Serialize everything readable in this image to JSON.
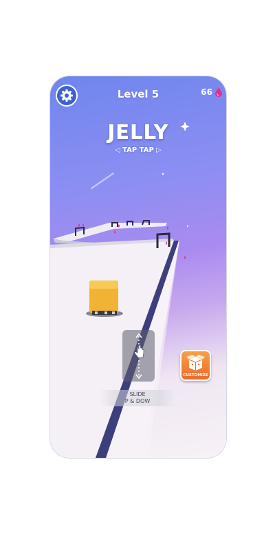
{
  "header": {
    "level_label": "Level 5",
    "drops_count": "66"
  },
  "logo": {
    "title": "JELLY",
    "subtitle": "TAP TAP"
  },
  "hint": {
    "line1": "SLIDE",
    "line2": "P & DOW"
  },
  "customize": {
    "label": "CUSTOMIZE"
  },
  "icons": {
    "settings": "gear-icon",
    "drops": "drop-icon",
    "swipe": "swipe-hand-icon",
    "customize": "box-icon"
  },
  "colors": {
    "sky_top": "#6f86ee",
    "sky_mid": "#a98bf0",
    "road": "#f4f1f6",
    "road_edge": "#3d3f7c",
    "jelly": "#f2b233",
    "drop": "#e0308a",
    "customize": "#ef6a2a",
    "settings": "#3d62cf"
  }
}
